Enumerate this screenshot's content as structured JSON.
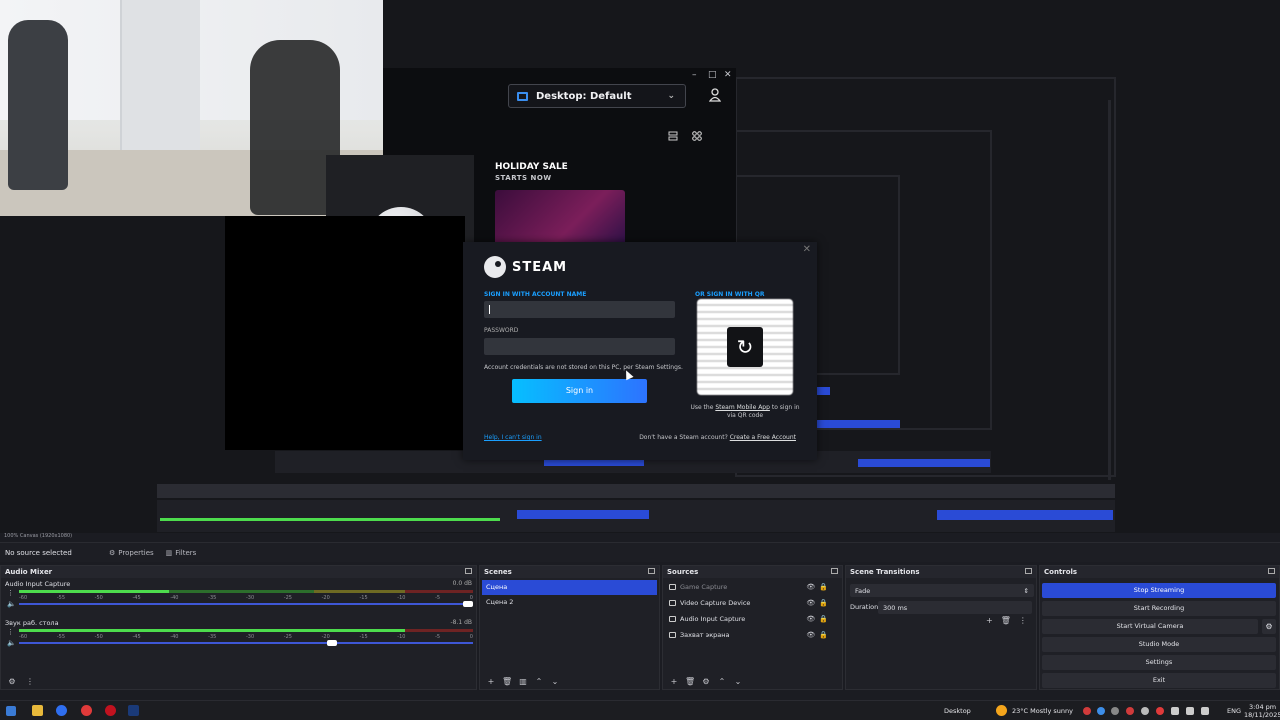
{
  "logitech": {
    "window_controls": [
      "–",
      "□",
      "✕"
    ],
    "desktop_select": "Desktop: Default",
    "holiday_title": "HOLIDAY SALE",
    "holiday_sub": "STARTS NOW"
  },
  "steam": {
    "brand": "STEAM",
    "close": "✕",
    "signin_label": "SIGN IN WITH ACCOUNT NAME",
    "password_label": "PASSWORD",
    "note": "Account credentials are not stored on this PC, per Steam Settings.",
    "signin_button": "Sign in",
    "qr_label": "OR SIGN IN WITH QR",
    "qr_refresh": "↻",
    "qr_help_1": "Use the",
    "qr_help_link": "Steam Mobile App",
    "qr_help_2": "to sign in via QR code",
    "cant_signin": "Help, I can't sign in",
    "no_account": "Don't have a Steam account?",
    "create_account": "Create a Free Account"
  },
  "obs": {
    "status": "100%   Canvas (1920x1080)",
    "no_source": "No source selected",
    "properties": "Properties",
    "filters": "Filters",
    "mixer": {
      "title": "Audio Mixer",
      "scale": [
        "-60",
        "-55",
        "-50",
        "-45",
        "-40",
        "-35",
        "-30",
        "-25",
        "-20",
        "-15",
        "-10",
        "-5",
        "0"
      ],
      "channels": [
        {
          "name": "Audio Input Capture",
          "db": "0.0 dB",
          "level": 0.33,
          "volume": 1.0
        },
        {
          "name": "Звук раб. стола",
          "db": "-8.1 dB",
          "level": 0.85,
          "volume": 0.7
        }
      ]
    },
    "scenes": {
      "title": "Scenes",
      "items": [
        "Сцена",
        "Сцена 2"
      ],
      "selected": 0
    },
    "sources": {
      "title": "Sources",
      "items": [
        {
          "name": "Game Capture",
          "dim": true
        },
        {
          "name": "Video Capture Device",
          "dim": false
        },
        {
          "name": "Audio Input Capture",
          "dim": false
        },
        {
          "name": "Захват экрана",
          "dim": false
        }
      ]
    },
    "transitions": {
      "title": "Scene Transitions",
      "type": "Fade",
      "duration_label": "Duration",
      "duration": "300 ms"
    },
    "controls": {
      "title": "Controls",
      "buttons": [
        "Stop Streaming",
        "Start Recording",
        "Start Virtual Camera",
        "Studio Mode",
        "Settings",
        "Exit"
      ]
    }
  },
  "taskbar": {
    "desktop_label": "Desktop",
    "weather": "23°C  Mostly sunny",
    "lang": "ENG",
    "time": "3:04 pm",
    "date": "18/11/2025"
  },
  "colors": {
    "accent": "#2a4bd6",
    "steam_blue": "#1a9fff",
    "bg": "#1b1c22"
  }
}
